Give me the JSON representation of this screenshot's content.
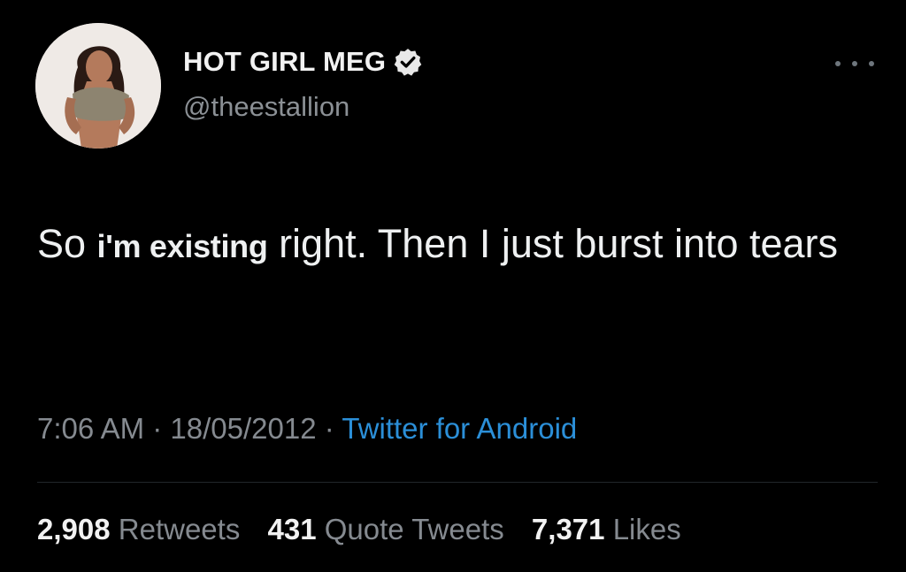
{
  "tweet": {
    "author": {
      "display_name": "HOT GIRL MEG",
      "handle": "@theestallion",
      "verified": true
    },
    "text": {
      "part1": "So ",
      "part2": "i'm existing",
      "part3": " right. Then I just burst into tears"
    },
    "meta": {
      "time": "7:06 AM",
      "sep1": " · ",
      "date": "18/05/2012",
      "sep2": " · ",
      "source": "Twitter for Android"
    },
    "stats": {
      "retweets_count": "2,908",
      "retweets_label": "Retweets",
      "quotes_count": "431",
      "quotes_label": "Quote Tweets",
      "likes_count": "7,371",
      "likes_label": "Likes"
    }
  },
  "icons": {
    "verified": "verified-badge-icon",
    "more": "more-horizontal-icon"
  },
  "colors": {
    "background": "#000000",
    "text": "#eef0f1",
    "muted": "#858a90",
    "link": "#2b8fd8"
  }
}
